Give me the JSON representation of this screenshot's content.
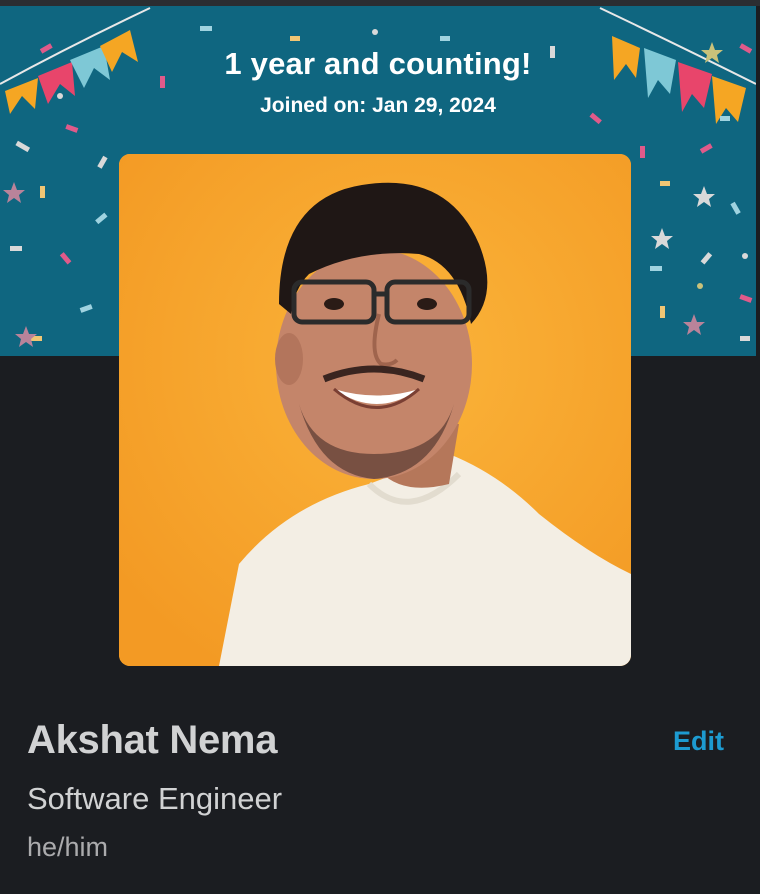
{
  "banner": {
    "title": "1 year and counting!",
    "joined": "Joined on: Jan 29, 2024"
  },
  "profile": {
    "name": "Akshat Nema",
    "title": "Software Engineer",
    "pronouns": "he/him",
    "photo_icon": "profile-photo"
  },
  "actions": {
    "edit_label": "Edit"
  },
  "colors": {
    "banner": "#0f6680",
    "background": "#1b1d21",
    "accent_link": "#1d9bd1",
    "photo_bg": "#f6a72e"
  }
}
